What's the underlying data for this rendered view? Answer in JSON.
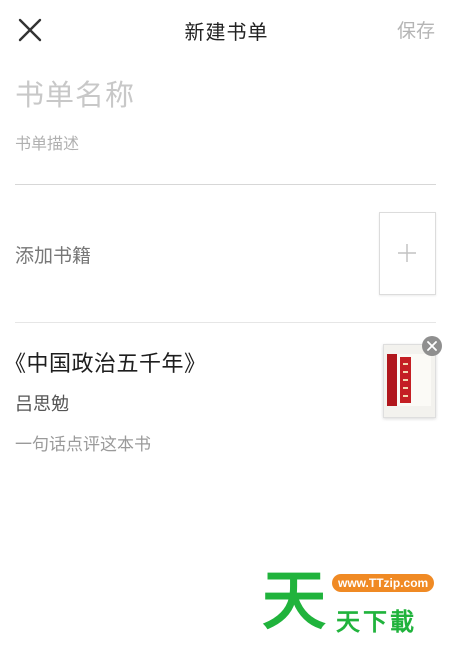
{
  "header": {
    "title": "新建书单",
    "save_label": "保存",
    "close_icon": "close-icon"
  },
  "form": {
    "name_placeholder": "书单名称",
    "description_placeholder": "书单描述"
  },
  "add_book": {
    "label": "添加书籍",
    "icon": "plus-icon"
  },
  "books": [
    {
      "title": "《中国政治五千年》",
      "author": "吕思勉",
      "comment_placeholder": "一句话点评这本书",
      "remove_icon": "remove-icon"
    }
  ],
  "watermark": {
    "big_char": "天",
    "url": "www.TTzip.com",
    "text": "天下載"
  },
  "colors": {
    "accent_green": "#20b33c",
    "watermark_orange": "#f08a24",
    "cover_red": "#c41f24",
    "placeholder_gray": "#c8c8c8"
  }
}
